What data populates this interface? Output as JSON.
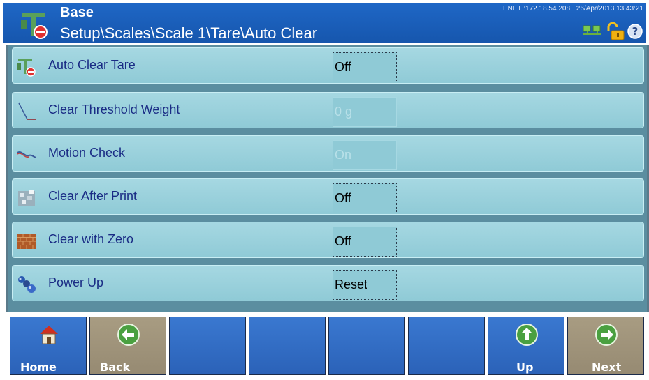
{
  "header": {
    "title": "Base",
    "path": "Setup\\Scales\\Scale 1\\Tare\\Auto Clear",
    "network": "ENET :172.18.54.208",
    "datetime": "26/Apr/2013 13:43:21"
  },
  "rows": [
    {
      "label": "Auto Clear Tare",
      "value": "Off",
      "enabled": true,
      "icon": "tare-clear-icon"
    },
    {
      "label": "Clear Threshold Weight",
      "value": "0 g",
      "enabled": false,
      "icon": "threshold-curve-icon"
    },
    {
      "label": "Motion Check",
      "value": "On",
      "enabled": false,
      "icon": "motion-check-icon"
    },
    {
      "label": "Clear After Print",
      "value": "Off",
      "enabled": true,
      "icon": "print-texture-icon"
    },
    {
      "label": "Clear with Zero",
      "value": "Off",
      "enabled": true,
      "icon": "brick-wall-icon"
    },
    {
      "label": "Power Up",
      "value": "Reset",
      "enabled": true,
      "icon": "power-up-icon"
    }
  ],
  "footer": {
    "home": "Home",
    "back": "Back",
    "up": "Up",
    "next": "Next"
  },
  "colors": {
    "header": "#1f67c6",
    "row": "#9fd3de",
    "label": "#1a2c85",
    "nav_blue": "#3270c8",
    "nav_tan": "#a0957c"
  }
}
